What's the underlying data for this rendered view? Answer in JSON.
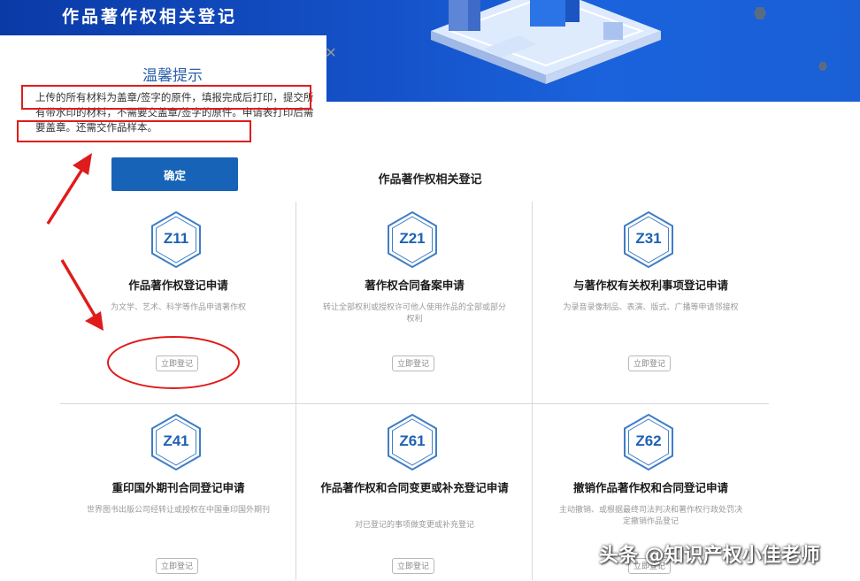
{
  "banner": {
    "title": "作品著作权相关登记"
  },
  "section_title": "作品著作权相关登记",
  "cards": [
    {
      "code": "Z11",
      "title": "作品著作权登记申请",
      "desc": "为文学、艺术、科学等作品申请著作权",
      "button": "立即登记"
    },
    {
      "code": "Z21",
      "title": "著作权合同备案申请",
      "desc": "转让全部权利或授权许可他人使用作品的全部或部分权利",
      "button": "立即登记"
    },
    {
      "code": "Z31",
      "title": "与著作权有关权利事项登记申请",
      "desc": "为录音录像制品、表演、版式、广播等申请邻接权",
      "button": "立即登记"
    },
    {
      "code": "Z41",
      "title": "重印国外期刊合同登记申请",
      "desc": "世界图书出版公司经转让或授权在中国重印国外期刊",
      "button": "立即登记"
    },
    {
      "code": "Z61",
      "title": "作品著作权和合同变更或补充登记申请",
      "desc": "对已登记的事项做变更或补充登记",
      "button": "立即登记"
    },
    {
      "code": "Z62",
      "title": "撤销作品著作权和合同登记申请",
      "desc": "主动撤销、或根据最终司法判决和著作权行政处罚决定撤销作品登记",
      "button": "立即登记"
    }
  ],
  "modal": {
    "title": "温馨提示",
    "text": "上传的所有材料为盖章/签字的原件，填报完成后打印，提交所有带水印的材料，不需要交盖章/签字的原件。申请表打印后需要盖章。还需交作品样本。",
    "confirm": "确定",
    "close_icon": "close-icon"
  },
  "watermark": "头条 @知识产权小佳老师",
  "colors": {
    "banner": "#1552c9",
    "accent": "#1663b7",
    "annotation": "#e01b1b",
    "hex": "#1d62b4"
  }
}
